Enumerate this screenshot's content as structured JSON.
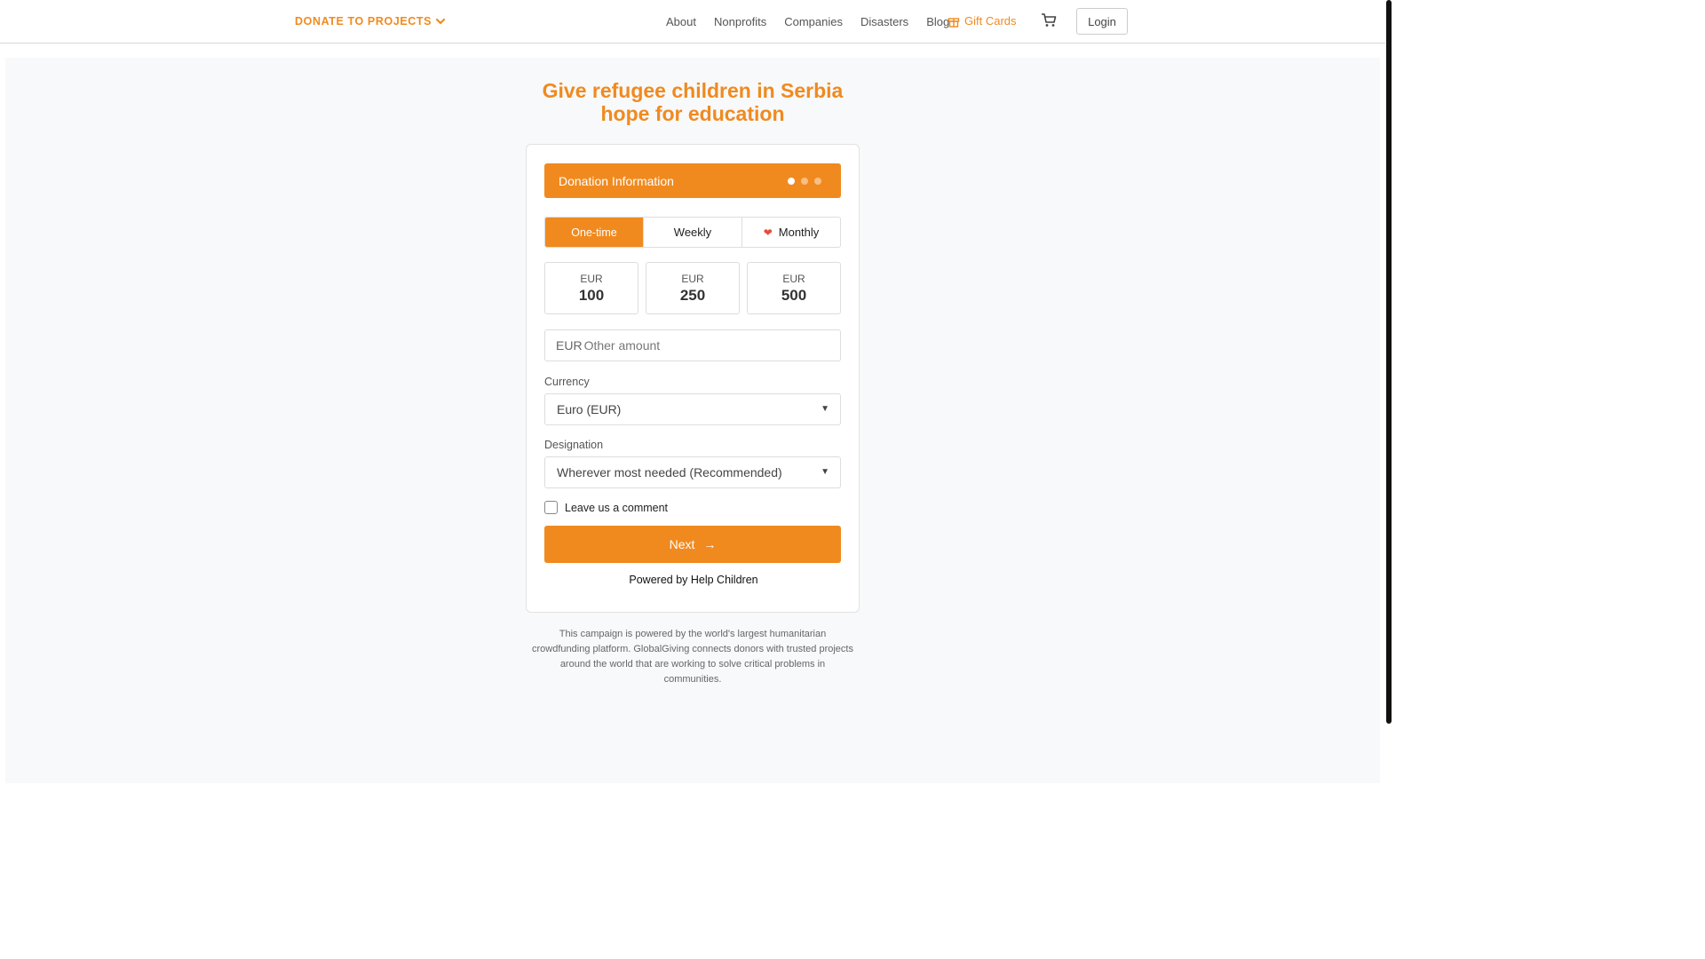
{
  "nav": {
    "donate_label": "DONATE TO PROJECTS",
    "links": [
      "About",
      "Nonprofits",
      "Companies",
      "Disasters",
      "Blog"
    ],
    "gift_cards": "Gift Cards",
    "login": "Login"
  },
  "campaign": {
    "title_line1": "Give refugee children in Serbia",
    "title_line2": "hope for education"
  },
  "form": {
    "header": "Donation Information",
    "steps_total": 3,
    "current_step": 1,
    "frequency": {
      "options": [
        "One-time",
        "Weekly",
        "Monthly"
      ],
      "selected": "One-time"
    },
    "amounts": [
      {
        "currency": "EUR",
        "value": "100"
      },
      {
        "currency": "EUR",
        "value": "250"
      },
      {
        "currency": "EUR",
        "value": "500"
      }
    ],
    "other_amount": {
      "prefix": "EUR",
      "placeholder": "Other amount",
      "value": ""
    },
    "currency_label": "Currency",
    "currency_value": "Euro (EUR)",
    "designation_label": "Designation",
    "designation_value": "Wherever most needed (Recommended)",
    "comment_label": "Leave us a comment",
    "next_label": "Next",
    "powered_by": "Powered by Help Children"
  },
  "footer": {
    "text": "This campaign is powered by the world's largest humanitarian crowdfunding platform. GlobalGiving connects donors with trusted projects around the world that are working to solve critical problems in communities."
  },
  "colors": {
    "accent": "#f08a1f",
    "heart": "#e74c3c"
  },
  "icons": [
    "chevron-down-icon",
    "gift-icon",
    "cart-icon",
    "heart-icon",
    "arrow-right-icon",
    "caret-down-icon"
  ]
}
